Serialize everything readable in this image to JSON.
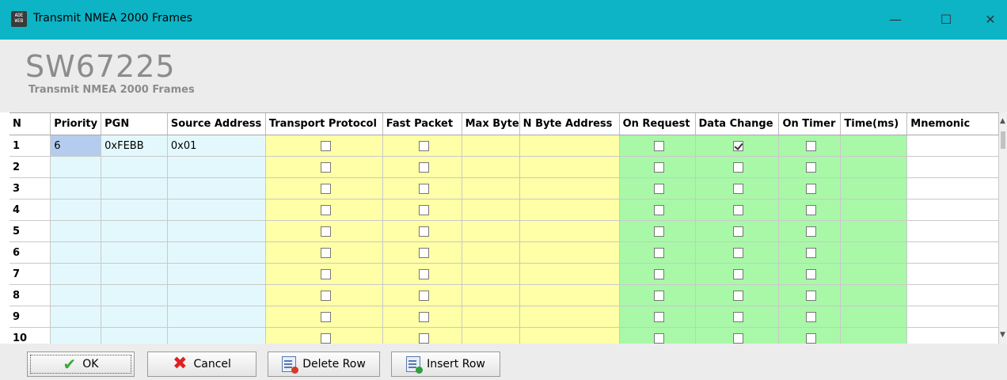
{
  "window": {
    "title": "Transmit NMEA 2000 Frames",
    "icon_text": "ADE WEB",
    "controls": {
      "minimize": "—",
      "maximize": "☐",
      "close": "✕"
    }
  },
  "header": {
    "product_code": "SW67225",
    "subtitle": "Transmit NMEA 2000 Frames"
  },
  "grid": {
    "columns": [
      {
        "label": "N",
        "color": "white"
      },
      {
        "label": "Priority",
        "color": "blue"
      },
      {
        "label": "PGN",
        "color": "blue"
      },
      {
        "label": "Source Address",
        "color": "blue"
      },
      {
        "label": "Transport Protocol",
        "color": "yellow",
        "type": "checkbox"
      },
      {
        "label": "Fast Packet",
        "color": "yellow",
        "type": "checkbox"
      },
      {
        "label": "Max Byte",
        "color": "yellow"
      },
      {
        "label": "N Byte Address",
        "color": "yellow"
      },
      {
        "label": "On Request",
        "color": "green",
        "type": "checkbox"
      },
      {
        "label": "Data Change",
        "color": "green",
        "type": "checkbox"
      },
      {
        "label": "On Timer",
        "color": "green",
        "type": "checkbox"
      },
      {
        "label": "Time(ms)",
        "color": "green"
      },
      {
        "label": "Mnemonic",
        "color": "white"
      }
    ],
    "rows": [
      {
        "n": "1",
        "priority": "6",
        "pgn": "0xFEBB",
        "source_address": "0x01",
        "transport_protocol": false,
        "fast_packet": false,
        "max_byte": "",
        "n_byte_address": "",
        "on_request": false,
        "data_change": true,
        "on_timer": false,
        "time_ms": "",
        "mnemonic": ""
      },
      {
        "n": "2",
        "priority": "",
        "pgn": "",
        "source_address": "",
        "transport_protocol": false,
        "fast_packet": false,
        "max_byte": "",
        "n_byte_address": "",
        "on_request": false,
        "data_change": false,
        "on_timer": false,
        "time_ms": "",
        "mnemonic": ""
      },
      {
        "n": "3",
        "priority": "",
        "pgn": "",
        "source_address": "",
        "transport_protocol": false,
        "fast_packet": false,
        "max_byte": "",
        "n_byte_address": "",
        "on_request": false,
        "data_change": false,
        "on_timer": false,
        "time_ms": "",
        "mnemonic": ""
      },
      {
        "n": "4",
        "priority": "",
        "pgn": "",
        "source_address": "",
        "transport_protocol": false,
        "fast_packet": false,
        "max_byte": "",
        "n_byte_address": "",
        "on_request": false,
        "data_change": false,
        "on_timer": false,
        "time_ms": "",
        "mnemonic": ""
      },
      {
        "n": "5",
        "priority": "",
        "pgn": "",
        "source_address": "",
        "transport_protocol": false,
        "fast_packet": false,
        "max_byte": "",
        "n_byte_address": "",
        "on_request": false,
        "data_change": false,
        "on_timer": false,
        "time_ms": "",
        "mnemonic": ""
      },
      {
        "n": "6",
        "priority": "",
        "pgn": "",
        "source_address": "",
        "transport_protocol": false,
        "fast_packet": false,
        "max_byte": "",
        "n_byte_address": "",
        "on_request": false,
        "data_change": false,
        "on_timer": false,
        "time_ms": "",
        "mnemonic": ""
      },
      {
        "n": "7",
        "priority": "",
        "pgn": "",
        "source_address": "",
        "transport_protocol": false,
        "fast_packet": false,
        "max_byte": "",
        "n_byte_address": "",
        "on_request": false,
        "data_change": false,
        "on_timer": false,
        "time_ms": "",
        "mnemonic": ""
      },
      {
        "n": "8",
        "priority": "",
        "pgn": "",
        "source_address": "",
        "transport_protocol": false,
        "fast_packet": false,
        "max_byte": "",
        "n_byte_address": "",
        "on_request": false,
        "data_change": false,
        "on_timer": false,
        "time_ms": "",
        "mnemonic": ""
      },
      {
        "n": "9",
        "priority": "",
        "pgn": "",
        "source_address": "",
        "transport_protocol": false,
        "fast_packet": false,
        "max_byte": "",
        "n_byte_address": "",
        "on_request": false,
        "data_change": false,
        "on_timer": false,
        "time_ms": "",
        "mnemonic": ""
      },
      {
        "n": "10",
        "priority": "",
        "pgn": "",
        "source_address": "",
        "transport_protocol": false,
        "fast_packet": false,
        "max_byte": "",
        "n_byte_address": "",
        "on_request": false,
        "data_change": false,
        "on_timer": false,
        "time_ms": "",
        "mnemonic": ""
      }
    ],
    "selected_cell": {
      "row": "1",
      "column": "Priority"
    }
  },
  "buttons": {
    "ok": {
      "label": "OK",
      "icon": "check-icon"
    },
    "cancel": {
      "label": "Cancel",
      "icon": "red-x-icon"
    },
    "delete_row": {
      "label": "Delete Row",
      "icon": "delete-row-icon"
    },
    "insert_row": {
      "label": "Insert Row",
      "icon": "insert-row-icon"
    }
  },
  "colors": {
    "titlebar": "#0cb4c6",
    "blue_cells": "#e3f8fc",
    "yellow_cells": "#ffffa8",
    "green_cells": "#a8f8a8",
    "selected_cell": "#b4ccee"
  }
}
